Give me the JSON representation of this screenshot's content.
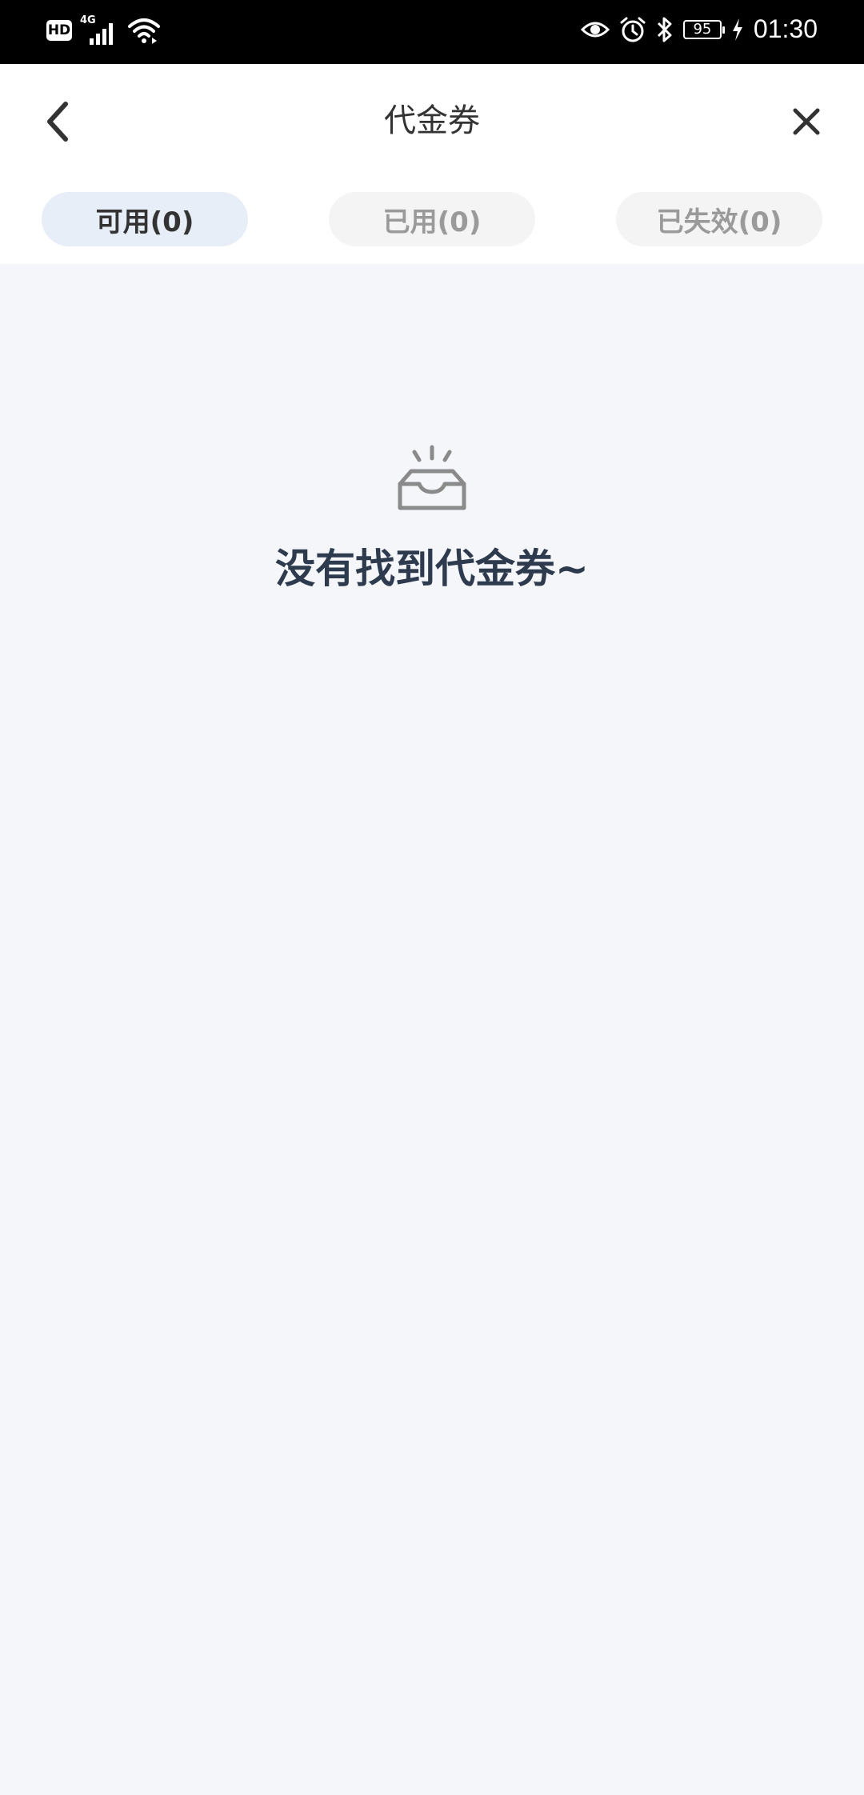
{
  "status_bar": {
    "hd_label": "HD",
    "network_label": "4G",
    "battery_level": "95",
    "time": "01:30",
    "icons": [
      "eye-icon",
      "alarm-icon",
      "bluetooth-icon",
      "battery-icon",
      "charging-icon"
    ]
  },
  "header": {
    "title": "代金券",
    "back_icon": "chevron-left-icon",
    "close_icon": "close-icon"
  },
  "tabs": [
    {
      "label": "可用(0)",
      "active": true
    },
    {
      "label": "已用(0)",
      "active": false
    },
    {
      "label": "已失效(0)",
      "active": false
    }
  ],
  "empty_state": {
    "icon": "empty-inbox-icon",
    "message": "没有找到代金券~"
  },
  "colors": {
    "page_background": "#f4f6f9",
    "active_tab_background": "#e8eef7",
    "inactive_tab_background": "#f4f4f4",
    "empty_text": "#2e3a4e"
  }
}
